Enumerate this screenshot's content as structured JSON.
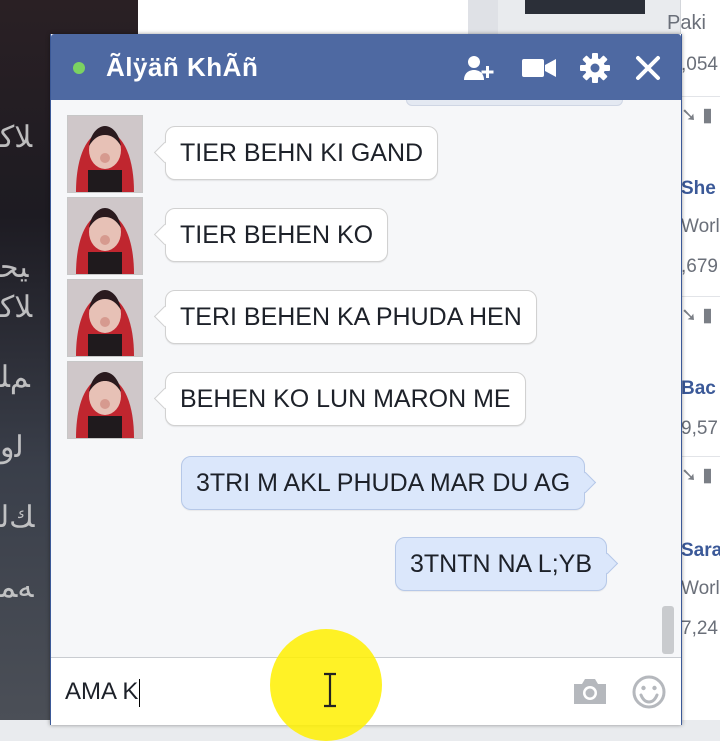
{
  "chat": {
    "title": "Ãlÿäñ KhÃñ",
    "status_color": "#7bd361",
    "header_color": "#4e69a2",
    "icons": [
      "add-friend-icon",
      "video-call-icon",
      "gear-icon",
      "close-icon"
    ],
    "messages": [
      {
        "side": "in",
        "text": "TIER BEHN KI GAND"
      },
      {
        "side": "in",
        "text": "TIER BEHEN KO"
      },
      {
        "side": "in",
        "text": "TERI BEHEN KA PHUDA HEN"
      },
      {
        "side": "in",
        "text": "BEHEN KO LUN MARON ME"
      },
      {
        "side": "out",
        "text": "3TRI M AKL PHUDA MAR DU AG"
      },
      {
        "side": "out",
        "text": "3TNTN NA L;YB"
      }
    ],
    "compose_value": "AMA K",
    "input_icons": [
      "camera-icon",
      "emoji-icon"
    ]
  },
  "background": {
    "top_right_label": "Paki",
    "right_column": [
      {
        "sub": ",054"
      },
      {
        "name": "She",
        "sub1": "Worl",
        "sub2": ",679"
      },
      {
        "name": "Bac",
        "sub": "9,57"
      },
      {
        "name": "Sara",
        "sub1": "Worl",
        "sub2": "7,24"
      }
    ]
  }
}
